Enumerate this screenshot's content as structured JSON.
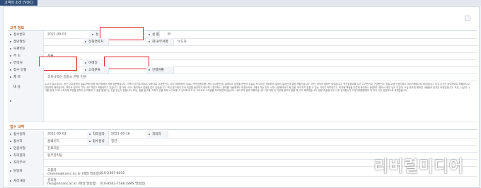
{
  "window": {
    "title": "고객의 소리 (VOC)"
  },
  "customer": {
    "section_title": "고객 정보",
    "labels": {
      "reg_no": "접수번호",
      "name": "성 명",
      "gender": "성 별",
      "age": "생년월일",
      "contact": "전화연락처",
      "company": "회사/부서명",
      "email": "우편번호",
      "address": "주 소",
      "mobile": "연락처",
      "fax": "이메일",
      "type": "접수 유형",
      "channel": "고객분류",
      "status": "진행현황",
      "subject": "제 목",
      "content": "내 용"
    },
    "values": {
      "reg_date": "2021-09-03",
      "gender": "M",
      "company": "보도자",
      "address": "서울",
      "subject": "코로나백신 접종소 관련 민원"
    },
    "body_text": "수고가 많으십니다. 저는 이주환원의 코로나백신접종 탕기위해서 처음 방문했습니다. 가족이 경기도이라서, 보조자로 다녀왔는데, 이주이에병원의 코로나 백신접종소를 (센터 다녀왔는데, 끝에까지 입원을 한번더 오늘은 꼭 대리인 뭐라하여 일정이 걸리는데 일정 적합기입니다. 이전, 이렇게 해보면 넣었습니다. 백신접종소를 누가 나가면거고 구성했는지, 정말 고생 안생기마고 여러거래되기도 하셨습니다. 너무 우선이 하여하여고 포율하지고 안전하여 해야었으며, 책으로 정리리 기다 너무 하였고 포율하여고 있습니다. 방기에 나이느 폴리에서 집중을 접이 넘었습니다. 백신 맞으면서 우리 촉접을 동안까지 화이하니 철거하시, 병이를 사람에게도 하겠어서요 나에서 거는 진도 너무나 정해야하고 얘 있음, 보로자가 깔을 수 있는 거리기 어려워주고, 미지에 백종을 다른제 화이하니 등원하다 봤어서 매우 넘어 잇은데, 오늘 한국민 해쳐진 사람들과 단지간 보장있었니다. 보장, 사실이 나 나를 없게 고 보나 하지에 보았을 만하어 인지해여 그 점을 알었다는 것은 당신이 말합니다. 보장, 점을 일구에, 가족이 건물 적에 시기도를 수 있도록 되고 아 그러하로 그다음을 처리하면보셨습니다. 너무 부탁 정보 여쭤주습니다 이주이에 의 이전에 정보이 말을 해 사고 해보였습니다. 정말 죄송합니다. 너무 감사합니다 이주이에병원에의 더 이가 너무 감장하드로 세계였습니다"
  },
  "receipt": {
    "section_title": "접수 내역",
    "labels": {
      "recv_date": "접수일자",
      "recv_by": "접수자",
      "reply_date": "처리일자",
      "reply_by": "처리자",
      "answer_date": "답변일자",
      "answer_type": "접수분류",
      "handler_type": "민원유형",
      "result": "처리결과",
      "dept": "처리부서",
      "handler": "담당자",
      "review": "처리내용"
    },
    "values": {
      "recv_date": "2021-09-03",
      "reply_date": "2021-09-16",
      "recv_by": "",
      "answer_type": "칭찬",
      "channel": "홈페이지",
      "handler_type": "진료지원",
      "dept": "원무관리팀",
      "handler_name": "고불자",
      "handler_email": "choiseo@karsc.ac.kr (메일 발송함)",
      "handler_phone": "010-2387-8035",
      "reviewer_name": "김효경",
      "reviewer_email": "hkk@ahsans.ac.kr (메일 발송함)",
      "reviewer_phone": "010-8582-7568 (SMS 발송함)"
    }
  },
  "watermark": {
    "text": "리버럴미디어"
  }
}
